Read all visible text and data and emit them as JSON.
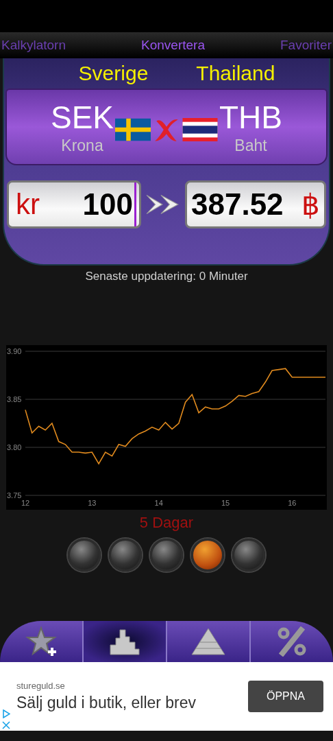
{
  "tabs": [
    {
      "label": "Kalkylatorn",
      "selected": false
    },
    {
      "label": "Konvertera",
      "selected": true
    },
    {
      "label": "Favoriter",
      "selected": false
    }
  ],
  "pair": {
    "from_country": "Sverige",
    "to_country": "Thailand",
    "from_code": "SEK",
    "to_code": "THB",
    "from_name": "Krona",
    "to_name": "Baht"
  },
  "amount": {
    "symbol": "kr",
    "value": "100"
  },
  "result": {
    "value": "387.52",
    "symbol": "฿"
  },
  "last_update": "Senaste uppdatering: 0 Minuter",
  "chart_data": {
    "type": "line",
    "x": [
      12.0,
      12.1,
      12.2,
      12.3,
      12.4,
      12.5,
      12.6,
      12.7,
      12.8,
      12.9,
      13.0,
      13.1,
      13.2,
      13.3,
      13.4,
      13.5,
      13.6,
      13.7,
      13.8,
      13.9,
      14.0,
      14.1,
      14.2,
      14.3,
      14.4,
      14.5,
      14.6,
      14.7,
      14.8,
      14.9,
      15.0,
      15.1,
      15.2,
      15.3,
      15.4,
      15.5,
      15.6,
      15.7,
      15.8,
      15.9,
      16.0,
      16.1,
      16.2,
      16.3,
      16.4,
      16.5
    ],
    "series": [
      {
        "color": "#e08a1e",
        "values": [
          3.839,
          3.815,
          3.822,
          3.818,
          3.825,
          3.806,
          3.803,
          3.795,
          3.795,
          3.794,
          3.795,
          3.783,
          3.795,
          3.791,
          3.803,
          3.801,
          3.809,
          3.814,
          3.817,
          3.821,
          3.818,
          3.826,
          3.819,
          3.825,
          3.847,
          3.855,
          3.836,
          3.842,
          3.84,
          3.84,
          3.843,
          3.848,
          3.854,
          3.853,
          3.856,
          3.858,
          3.868,
          3.88,
          3.881,
          3.882,
          3.873,
          3.873,
          3.873,
          3.873,
          3.873,
          3.873
        ]
      }
    ],
    "xlim": [
      12,
      16.5
    ],
    "ylim": [
      3.75,
      3.9
    ],
    "xticks": [
      12,
      13,
      14,
      15,
      16
    ],
    "yticks": [
      {
        "value": 3.75,
        "label": "3.75"
      },
      {
        "value": 3.8,
        "label": "3.80"
      },
      {
        "value": 3.85,
        "label": "3.85"
      },
      {
        "value": 3.9,
        "label": "3.90"
      }
    ]
  },
  "period_label": "5 Dagar",
  "periods": [
    {
      "selected": false
    },
    {
      "selected": false
    },
    {
      "selected": false
    },
    {
      "selected": true
    },
    {
      "selected": false
    }
  ],
  "bottom_nav": [
    {
      "kind": "star",
      "selected": false
    },
    {
      "kind": "chart",
      "selected": true
    },
    {
      "kind": "pyramid",
      "selected": false
    },
    {
      "kind": "percent",
      "selected": false
    }
  ],
  "ad": {
    "domain": "stureguld.se",
    "headline": "Sälj guld i butik, eller brev",
    "button": "ÖPPNA"
  }
}
